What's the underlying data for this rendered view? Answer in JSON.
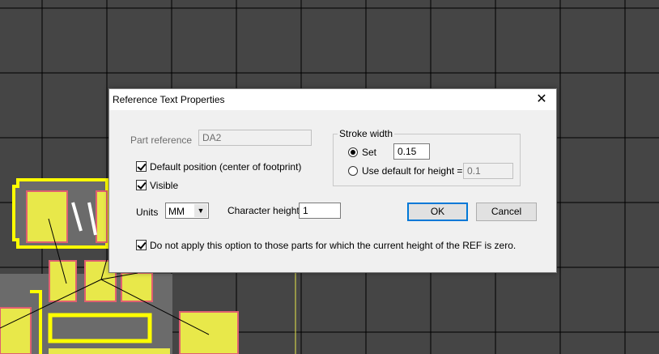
{
  "dialog": {
    "title": "Reference Text Properties",
    "close_glyph": "✕",
    "part_reference": {
      "label": "Part reference",
      "value": "DA2"
    },
    "default_position": {
      "label": "Default position (center of footprint)",
      "checked": true
    },
    "visible": {
      "label": "Visible",
      "checked": true
    },
    "units": {
      "label": "Units",
      "value": "MM"
    },
    "character_height": {
      "label": "Character height",
      "value": "1"
    },
    "stroke_width": {
      "group_title": "Stroke width",
      "set": {
        "label": "Set",
        "value": "0.15",
        "selected": true
      },
      "use_default": {
        "label": "Use default for height =",
        "value": "0.1",
        "selected": false
      }
    },
    "ok_label": "OK",
    "cancel_label": "Cancel",
    "zero_height_option": {
      "label": "Do not apply this option to those parts for which the current height of the REF is zero.",
      "checked": true
    }
  },
  "colors": {
    "canvas_bg": "#454545",
    "grid": "#000000",
    "pad_outline": "#e8e84a",
    "pad_fill": "#e8e84a",
    "pad_inner": "#e06070",
    "silkscreen": "#ffff00",
    "footprint_bg": "#6b6b6b"
  }
}
